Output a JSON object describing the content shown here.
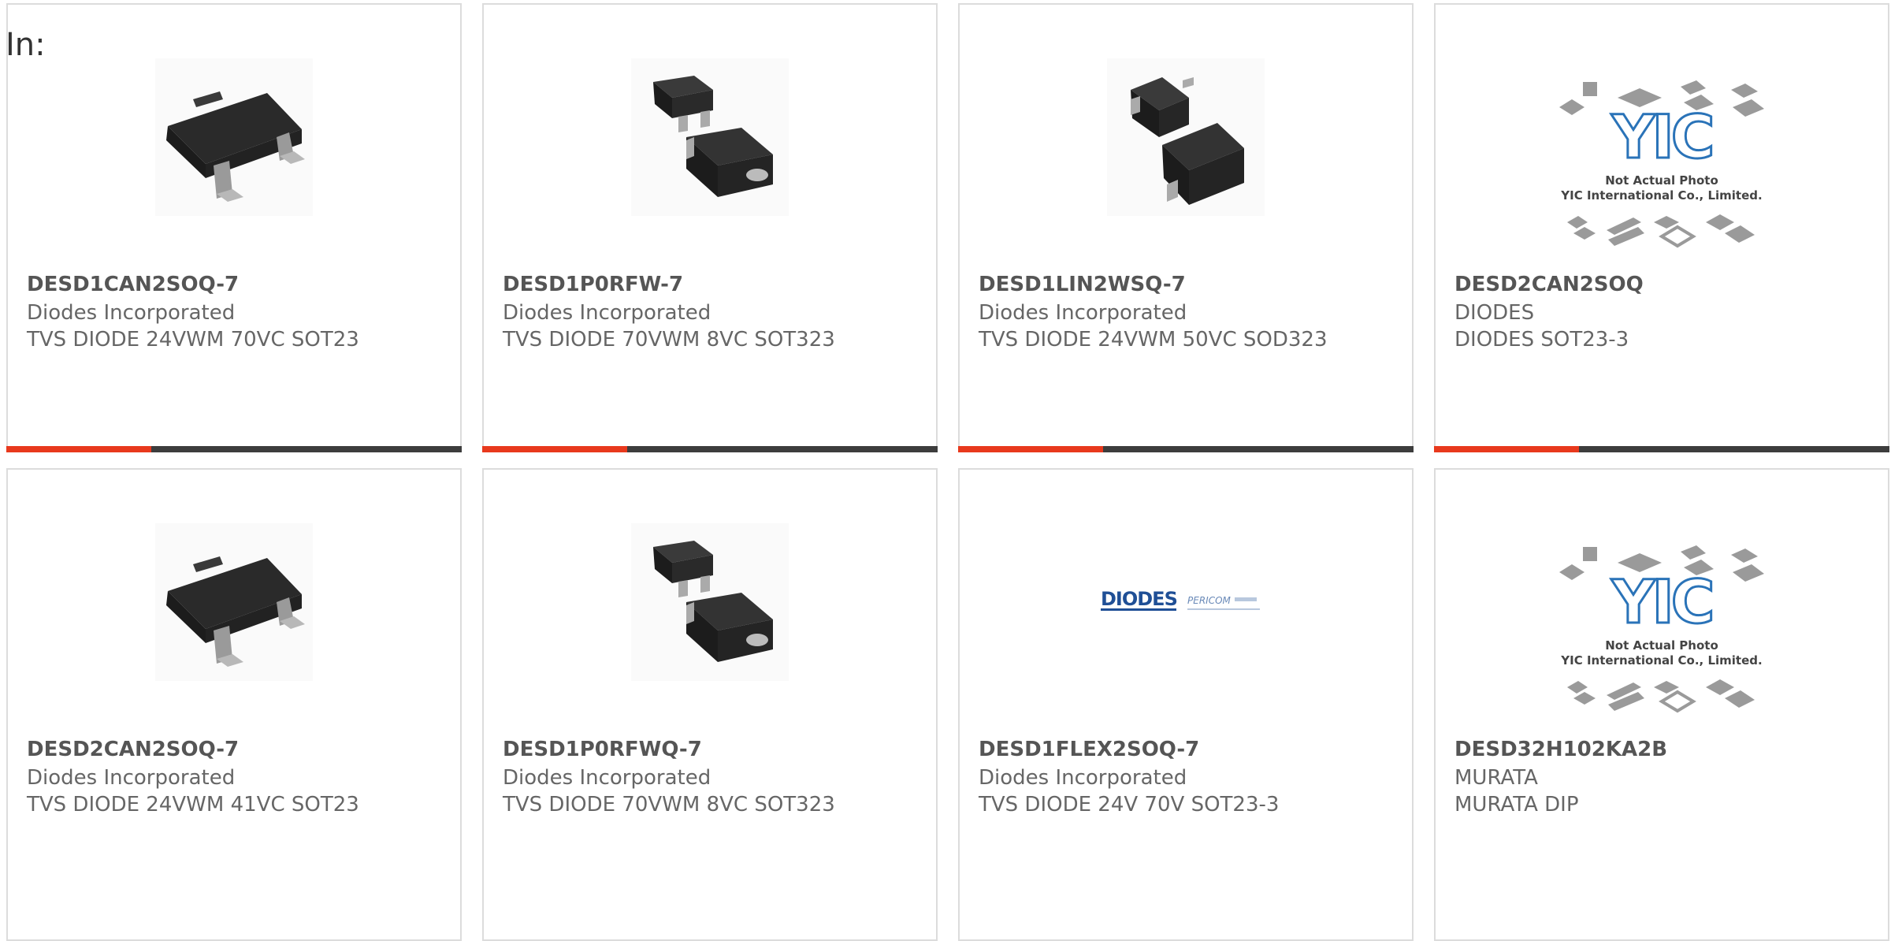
{
  "header": {
    "label": "In:"
  },
  "accent_color": "#e8391d",
  "bar_color": "#3d3d3d",
  "products": [
    {
      "part": "DESD1CAN2SOQ-7",
      "manufacturer": "Diodes Incorporated",
      "description": "TVS DIODE 24VWM 70VC SOT23",
      "image": "sot23-package-icon"
    },
    {
      "part": "DESD1P0RFW-7",
      "manufacturer": "Diodes Incorporated",
      "description": "TVS DIODE 70VWM 8VC SOT323",
      "image": "sot323-package-icon"
    },
    {
      "part": "DESD1LIN2WSQ-7",
      "manufacturer": "Diodes Incorporated",
      "description": "TVS DIODE 24VWM 50VC SOD323",
      "image": "sod323-package-icon"
    },
    {
      "part": "DESD2CAN2SOQ",
      "manufacturer": "DIODES",
      "description": "DIODES SOT23-3",
      "image": "placeholder-photo-icon",
      "image_text": [
        "Not Actual Photo",
        "YIC International Co., Limited."
      ]
    },
    {
      "part": "DESD2CAN2SOQ-7",
      "manufacturer": "Diodes Incorporated",
      "description": "TVS DIODE 24VWM 41VC SOT23",
      "image": "sot23-package-icon"
    },
    {
      "part": "DESD1P0RFWQ-7",
      "manufacturer": "Diodes Incorporated",
      "description": "TVS DIODE 70VWM 8VC SOT323",
      "image": "sot323-package-icon"
    },
    {
      "part": "DESD1FLEX2SOQ-7",
      "manufacturer": "Diodes Incorporated",
      "description": "TVS DIODE 24V 70V SOT23-3",
      "image": "diodes-pericom-logo-icon",
      "logo_text": [
        "DIODES",
        "PERICOM"
      ]
    },
    {
      "part": "DESD32H102KA2B",
      "manufacturer": "MURATA",
      "description": "MURATA DIP",
      "image": "placeholder-photo-icon",
      "image_text": [
        "Not Actual Photo",
        "YIC International Co., Limited."
      ]
    }
  ]
}
